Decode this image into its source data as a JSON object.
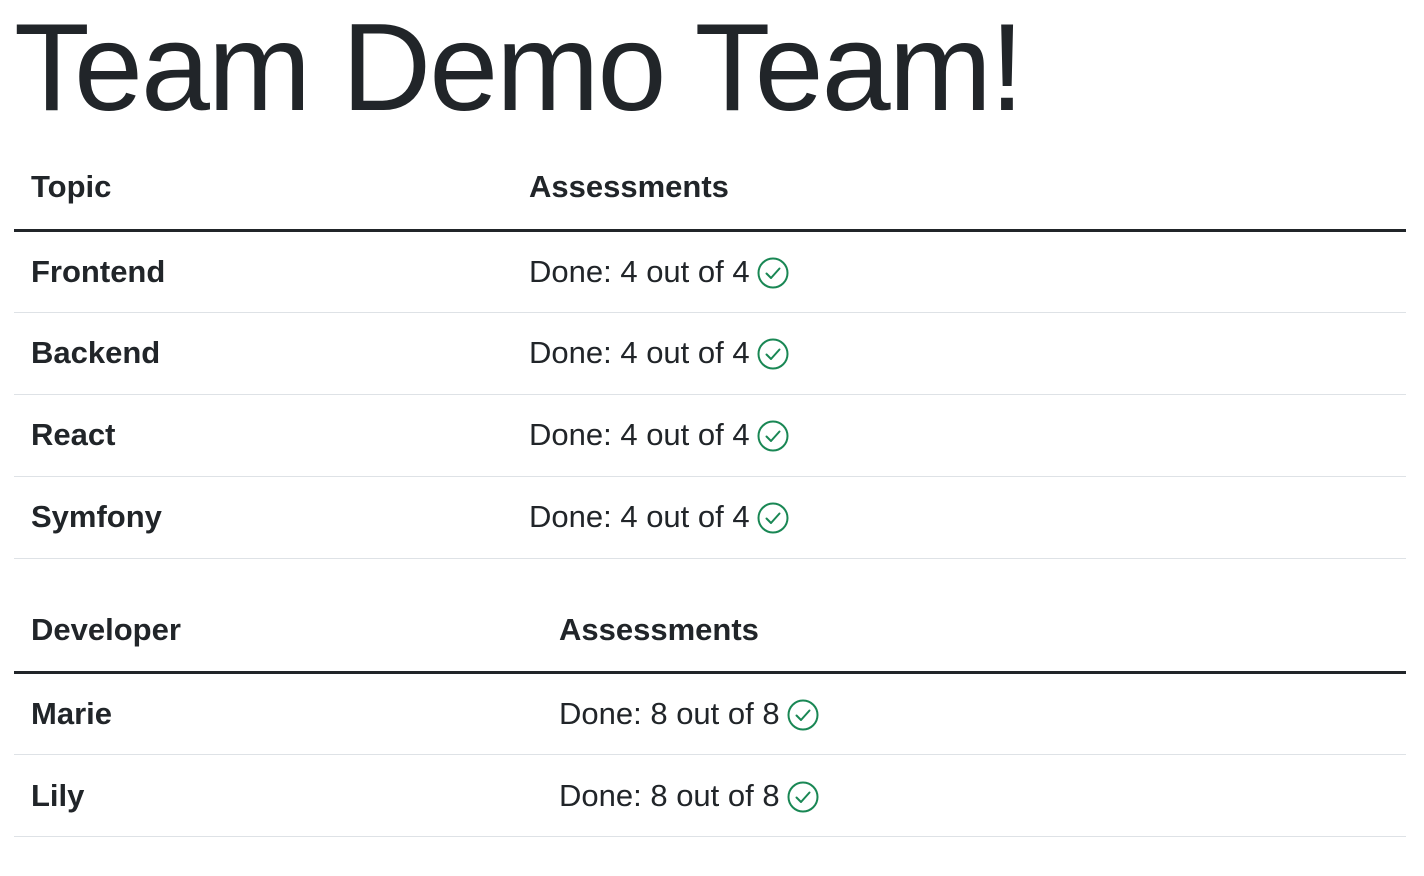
{
  "page": {
    "title": "Team Demo Team!"
  },
  "topics_table": {
    "headers": {
      "topic": "Topic",
      "assessments": "Assessments"
    },
    "rows": [
      {
        "name": "Frontend",
        "status": "Done: 4 out of 4"
      },
      {
        "name": "Backend",
        "status": "Done: 4 out of 4"
      },
      {
        "name": "React",
        "status": "Done: 4 out of 4"
      },
      {
        "name": "Symfony",
        "status": "Done: 4 out of 4"
      }
    ]
  },
  "developers_table": {
    "headers": {
      "developer": "Developer",
      "assessments": "Assessments"
    },
    "rows": [
      {
        "name": "Marie",
        "status": "Done: 8 out of 8"
      },
      {
        "name": "Lily",
        "status": "Done: 8 out of 8"
      }
    ]
  },
  "icons": {
    "completed": "check-circle-icon"
  },
  "colors": {
    "text": "#212529",
    "success": "#198754",
    "header_rule": "#212529",
    "row_rule": "#dee2e6"
  }
}
